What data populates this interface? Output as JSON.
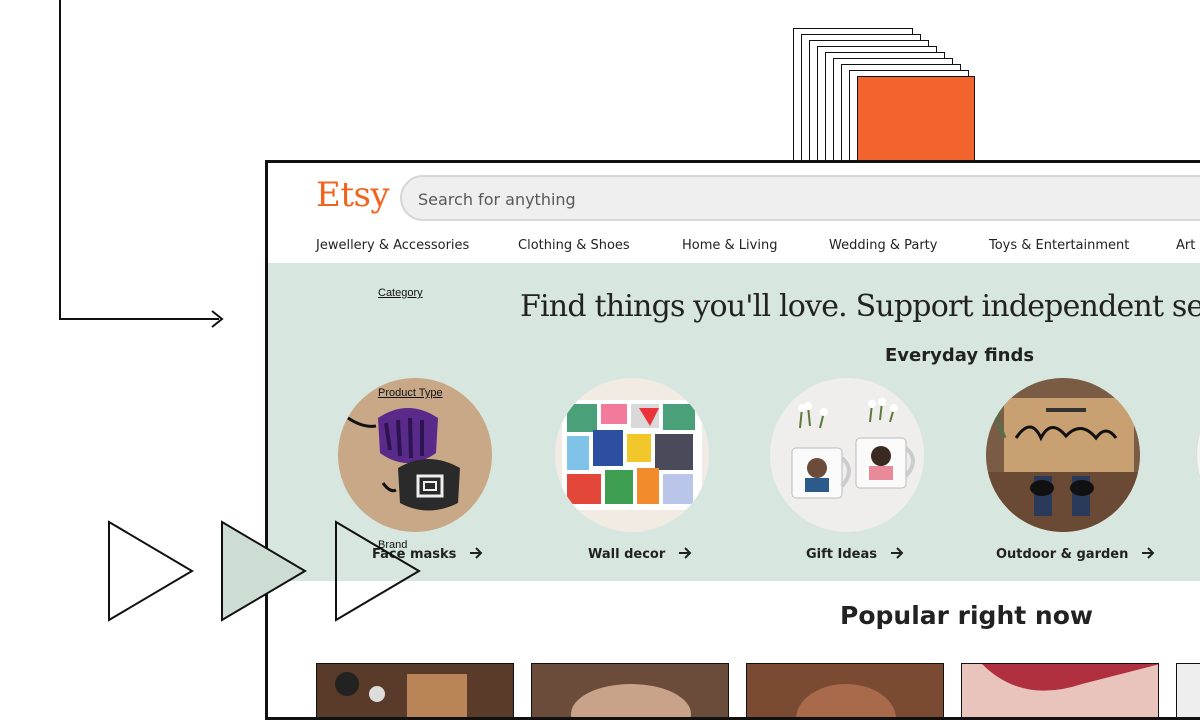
{
  "header": {
    "logo": "Etsy",
    "search_placeholder": "Search for anything"
  },
  "nav": {
    "items": [
      {
        "label": "Jewellery & Accessories"
      },
      {
        "label": "Clothing & Shoes"
      },
      {
        "label": "Home & Living"
      },
      {
        "label": "Wedding & Party"
      },
      {
        "label": "Toys & Entertainment"
      },
      {
        "label": "Art &"
      }
    ]
  },
  "hero": {
    "title": "Find things you'll love. Support independent sellers.",
    "subtitle": "Everyday finds",
    "annotations": {
      "category": "Category",
      "product_type": "Product Type",
      "brand": "Brand"
    },
    "categories": [
      {
        "label": "Face masks",
        "icon": "arrow-right-icon"
      },
      {
        "label": "Wall decor",
        "icon": "arrow-right-icon"
      },
      {
        "label": "Gift Ideas",
        "icon": "arrow-right-icon"
      },
      {
        "label": "Outdoor & garden",
        "icon": "arrow-right-icon"
      }
    ]
  },
  "popular": {
    "title": "Popular right now"
  },
  "colors": {
    "brand": "#f1641e",
    "hero_bg": "#d7e7df",
    "decor_orange": "#f1642e",
    "play_fill": "#cdddd4"
  }
}
